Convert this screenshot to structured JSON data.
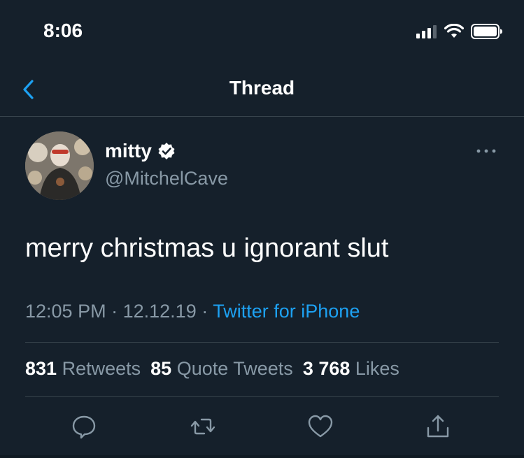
{
  "status_bar": {
    "time": "8:06"
  },
  "nav": {
    "title": "Thread"
  },
  "tweet": {
    "display_name": "mitty",
    "handle": "@MitchelCave",
    "text": "merry christmas u ignorant slut",
    "time": "12:05 PM",
    "date": "12.12.19",
    "separator": "·",
    "source": "Twitter for iPhone",
    "verified": true
  },
  "stats": {
    "retweets_count": "831",
    "retweets_label": "Retweets",
    "quotes_count": "85",
    "quotes_label": "Quote Tweets",
    "likes_count": "3 768",
    "likes_label": "Likes"
  },
  "colors": {
    "background": "#15202b",
    "accent": "#1da1f2",
    "secondary_text": "#8899a6",
    "divider": "#38444d"
  },
  "icons": {
    "back": "chevron-left-icon",
    "more": "more-horizontal-icon",
    "reply": "reply-icon",
    "retweet": "retweet-icon",
    "like": "heart-icon",
    "share": "share-icon",
    "verified": "verified-badge-icon"
  }
}
